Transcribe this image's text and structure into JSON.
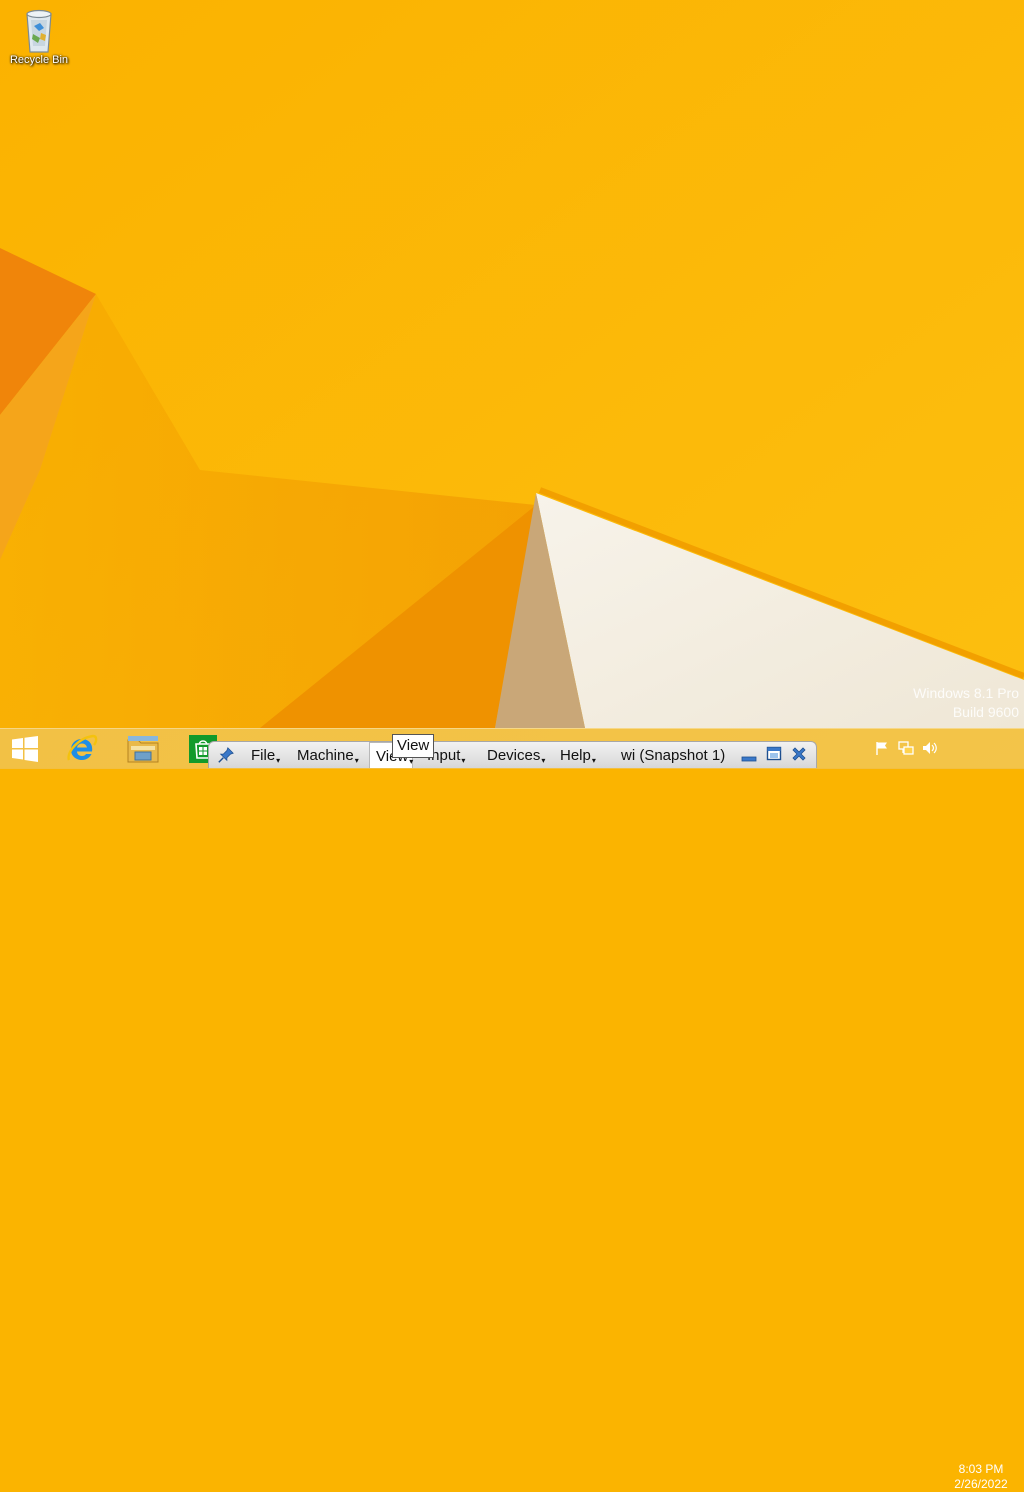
{
  "desktop": {
    "icons": [
      {
        "label": "Recycle Bin",
        "icon": "recycle-bin-icon"
      }
    ],
    "watermark": {
      "line1": "Windows 8.1 Pro",
      "line2": "Build 9600"
    },
    "colors": {
      "wallpaper": "#fbb400",
      "accent_orange": "#f08c00",
      "white_facet": "#f3efe6"
    }
  },
  "taskbar": {
    "pinned": [
      {
        "name": "Start",
        "icon": "windows-logo-icon"
      },
      {
        "name": "Internet Explorer",
        "icon": "internet-explorer-icon"
      },
      {
        "name": "File Explorer",
        "icon": "file-explorer-icon"
      },
      {
        "name": "Store",
        "icon": "store-icon"
      }
    ],
    "tray": {
      "icons": [
        "action-center-flag-icon",
        "network-icon",
        "volume-icon"
      ],
      "time": "8:03 PM",
      "date": "2/26/2022"
    }
  },
  "vm_toolbar": {
    "pin_icon": "pin-icon",
    "menus": {
      "file": "File",
      "machine": "Machine",
      "view": "View",
      "input": "Input",
      "devices": "Devices",
      "help": "Help"
    },
    "title": "wi (Snapshot 1)",
    "buttons": [
      "minimize-icon",
      "restore-icon",
      "close-icon"
    ]
  },
  "tooltip": {
    "text": "View"
  }
}
